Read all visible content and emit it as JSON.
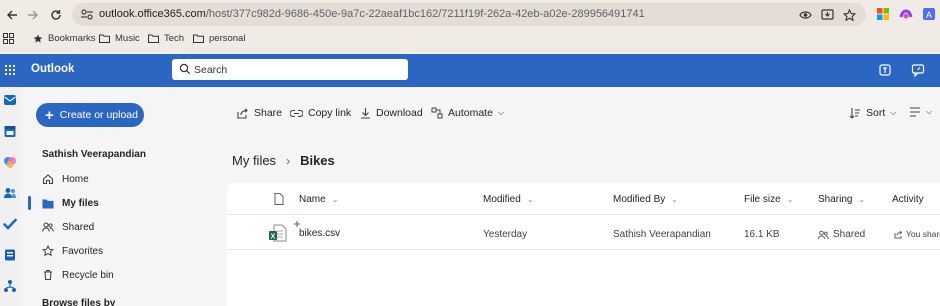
{
  "browser": {
    "url_host": "outlook.office365.com",
    "url_path": "/host/377c982d-9686-450e-9a7c-22aeaf1bc162/7211f19f-262a-42eb-a02e-289956491741",
    "bookmarks": [
      {
        "label": "Bookmarks",
        "icon": "star-icon"
      },
      {
        "label": "Music",
        "icon": "folder-icon"
      },
      {
        "label": "Tech",
        "icon": "folder-icon"
      },
      {
        "label": "personal",
        "icon": "folder-icon"
      }
    ]
  },
  "header": {
    "app_name": "Outlook",
    "search_placeholder": "Search"
  },
  "nav": {
    "create_label": "Create or upload",
    "user_name": "Sathish Veerapandian",
    "items": [
      {
        "label": "Home",
        "icon": "home-icon"
      },
      {
        "label": "My files",
        "icon": "folder-icon",
        "active": true
      },
      {
        "label": "Shared",
        "icon": "people-icon"
      },
      {
        "label": "Favorites",
        "icon": "star-icon"
      },
      {
        "label": "Recycle bin",
        "icon": "trash-icon"
      }
    ],
    "browse_label": "Browse files by"
  },
  "toolbar": {
    "share": "Share",
    "copy_link": "Copy link",
    "download": "Download",
    "automate": "Automate",
    "sort": "Sort"
  },
  "breadcrumb": {
    "parent": "My files",
    "current": "Bikes"
  },
  "table": {
    "columns": {
      "name": "Name",
      "modified": "Modified",
      "modified_by": "Modified By",
      "file_size": "File size",
      "sharing": "Sharing",
      "activity": "Activity"
    },
    "rows": [
      {
        "name": "bikes.csv",
        "modified": "Yesterday",
        "modified_by": "Sathish Veerapandian",
        "file_size": "16.1 KB",
        "sharing": "Shared",
        "activity": "You share"
      }
    ]
  },
  "colors": {
    "brand": "#2b66c3",
    "excel": "#1d6f42"
  }
}
